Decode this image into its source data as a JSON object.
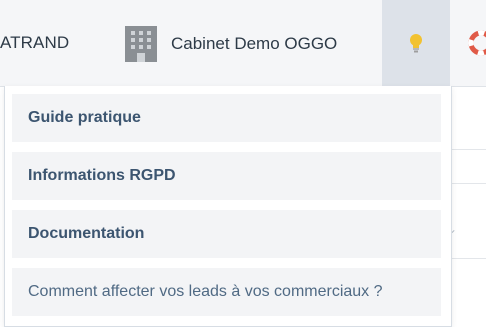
{
  "header": {
    "user_name": "ATRAND",
    "office_name": "Cabinet Demo OGGO",
    "icons": {
      "office": "building-icon",
      "help": "lightbulb-icon",
      "support": "lifebuoy-icon"
    },
    "colors": {
      "bulb": "#f2c230",
      "lifebuoy": "#e05a47"
    }
  },
  "help_menu": {
    "items": [
      {
        "label": "Guide pratique",
        "style": "bold"
      },
      {
        "label": "Informations RGPD",
        "style": "bold"
      },
      {
        "label": "Documentation",
        "style": "bold"
      },
      {
        "label": "Comment affecter vos leads à vos commerciaux ?",
        "style": "plain"
      }
    ]
  }
}
